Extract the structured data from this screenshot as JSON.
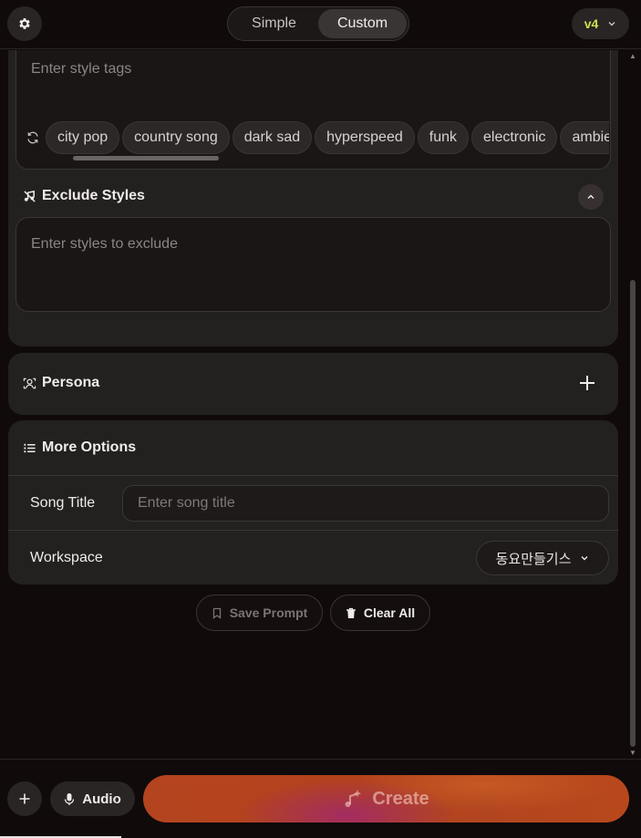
{
  "header": {
    "modes": [
      {
        "label": "Simple",
        "active": false
      },
      {
        "label": "Custom",
        "active": true
      }
    ],
    "version_label": "v4",
    "icons": {
      "settings": "gear-icon",
      "version_dropdown": "chevron-down-icon"
    }
  },
  "styles": {
    "placeholder": "Enter style tags",
    "tags": [
      "city pop",
      "country song",
      "dark sad",
      "hyperspeed",
      "funk",
      "electronic",
      "ambient"
    ],
    "icons": {
      "refresh": "refresh-icon"
    }
  },
  "exclude_styles": {
    "title": "Exclude Styles",
    "placeholder": "Enter styles to exclude",
    "icons": {
      "header": "music-note-off-icon",
      "collapse": "chevron-up-icon"
    }
  },
  "persona": {
    "title": "Persona",
    "icons": {
      "header": "persona-icon",
      "add": "plus-icon"
    }
  },
  "more_options": {
    "title": "More Options",
    "song_title_label": "Song Title",
    "song_title_placeholder": "Enter song title",
    "workspace_label": "Workspace",
    "workspace_value": "동요만들기스",
    "icons": {
      "header": "list-icon",
      "workspace_dropdown": "chevron-down-icon"
    }
  },
  "actions": {
    "save_prompt_label": "Save Prompt",
    "clear_all_label": "Clear All",
    "icons": {
      "save": "bookmark-icon",
      "clear": "trash-icon"
    }
  },
  "bottom": {
    "audio_label": "Audio",
    "create_label": "Create",
    "icons": {
      "add": "plus-icon",
      "audio": "microphone-icon",
      "create": "music-sparkle-icon"
    }
  },
  "colors": {
    "background": "#100a0a",
    "card": "#232020",
    "version_accent": "#c9e34a",
    "create_gradient_start": "#b4441f",
    "create_gradient_accent": "#a0286e"
  }
}
